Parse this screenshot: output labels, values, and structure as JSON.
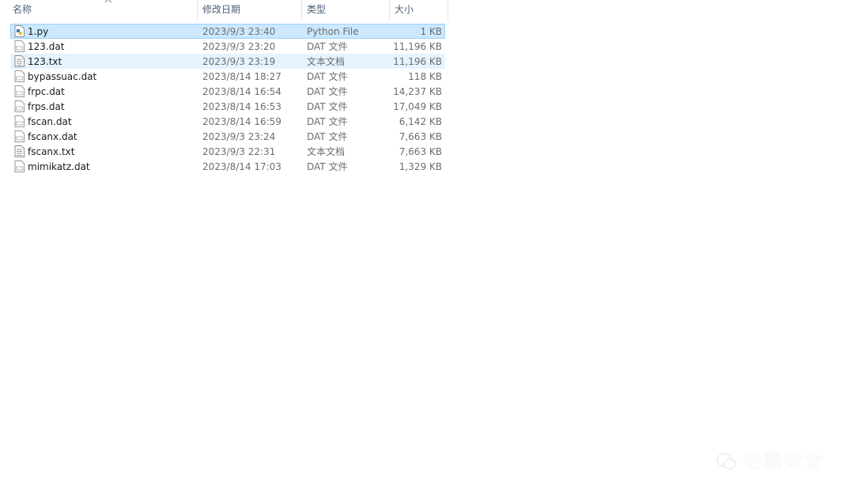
{
  "header": {
    "name": "名称",
    "date": "修改日期",
    "type": "类型",
    "size": "大小"
  },
  "files": [
    {
      "name": "1.py",
      "date": "2023/9/3 23:40",
      "type": "Python File",
      "size": "1 KB",
      "icon": "python-file-icon",
      "state": "selected"
    },
    {
      "name": "123.dat",
      "date": "2023/9/3 23:20",
      "type": "DAT 文件",
      "size": "11,196 KB",
      "icon": "dat-file-icon",
      "state": ""
    },
    {
      "name": "123.txt",
      "date": "2023/9/3 23:19",
      "type": "文本文档",
      "size": "11,196 KB",
      "icon": "text-file-icon",
      "state": "hover"
    },
    {
      "name": "bypassuac.dat",
      "date": "2023/8/14 18:27",
      "type": "DAT 文件",
      "size": "118 KB",
      "icon": "dat-file-icon",
      "state": ""
    },
    {
      "name": "frpc.dat",
      "date": "2023/8/14 16:54",
      "type": "DAT 文件",
      "size": "14,237 KB",
      "icon": "dat-file-icon",
      "state": ""
    },
    {
      "name": "frps.dat",
      "date": "2023/8/14 16:53",
      "type": "DAT 文件",
      "size": "17,049 KB",
      "icon": "dat-file-icon",
      "state": ""
    },
    {
      "name": "fscan.dat",
      "date": "2023/8/14 16:59",
      "type": "DAT 文件",
      "size": "6,142 KB",
      "icon": "dat-file-icon",
      "state": ""
    },
    {
      "name": "fscanx.dat",
      "date": "2023/9/3 23:24",
      "type": "DAT 文件",
      "size": "7,663 KB",
      "icon": "dat-file-icon",
      "state": ""
    },
    {
      "name": "fscanx.txt",
      "date": "2023/9/3 22:31",
      "type": "文本文档",
      "size": "7,663 KB",
      "icon": "text-file-icon",
      "state": ""
    },
    {
      "name": "mimikatz.dat",
      "date": "2023/8/14 17:03",
      "type": "DAT 文件",
      "size": "1,329 KB",
      "icon": "dat-file-icon",
      "state": ""
    }
  ],
  "watermark": {
    "text": "老鑫安全"
  },
  "colors": {
    "selected_bg": "#cce8ff",
    "selected_border": "#99d1ff",
    "hover_bg": "#e5f3ff",
    "header_text": "#4c607a"
  }
}
